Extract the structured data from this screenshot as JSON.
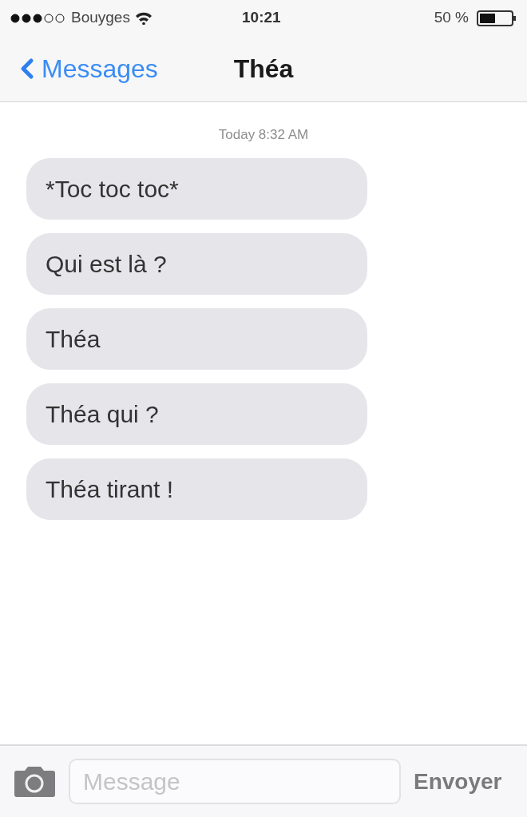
{
  "status_bar": {
    "carrier": "Bouyges",
    "time": "10:21",
    "battery": "50 %"
  },
  "nav": {
    "back": "Messages",
    "title": "Théa"
  },
  "timestamp": "Today 8:32 AM",
  "messages": [
    {
      "text": "*Toc toc toc*"
    },
    {
      "text": "Qui est là ?"
    },
    {
      "text": "Théa"
    },
    {
      "text": "Théa qui ?"
    },
    {
      "text": "Théa tirant !"
    }
  ],
  "composer": {
    "placeholder": "Message",
    "send": "Envoyer"
  }
}
